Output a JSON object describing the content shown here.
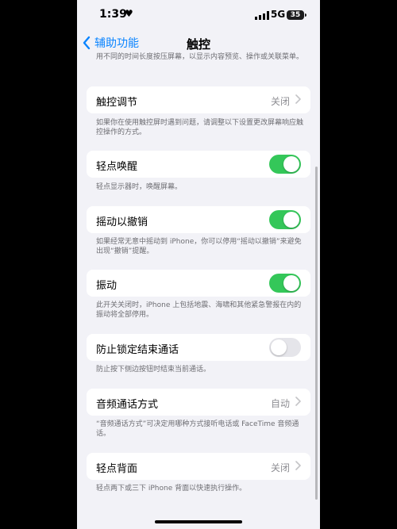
{
  "status": {
    "time": "1:39",
    "heart": "♥",
    "network": "5G",
    "battery": "35"
  },
  "nav": {
    "back_label": "辅助功能",
    "title": "触控"
  },
  "intro_note": "用不同的时间长度按压屏幕，以显示内容预览、操作或关联菜单。",
  "items": [
    {
      "label": "触控调节",
      "type": "link",
      "value": "关闭",
      "note": "如果你在使用触控屏时遇到问题，请调整以下设置更改屏幕响应触控操作的方式。"
    },
    {
      "label": "轻点唤醒",
      "type": "toggle",
      "state": true,
      "note": "轻点显示器时，唤醒屏幕。"
    },
    {
      "label": "摇动以撤销",
      "type": "toggle",
      "state": true,
      "note": "如果经常无意中摇动到 iPhone，你可以停用“摇动以撤销”来避免出现“撤销”提醒。"
    },
    {
      "label": "振动",
      "type": "toggle",
      "state": true,
      "note": "此开关关闭时，iPhone 上包括地震、海啸和其他紧急警报在内的振动将全部停用。"
    },
    {
      "label": "防止锁定结束通话",
      "type": "toggle",
      "state": false,
      "note": "防止按下侧边按钮时结束当前通话。"
    },
    {
      "label": "音频通话方式",
      "type": "link",
      "value": "自动",
      "note": "“音频通话方式”可决定用哪种方式接听电话或 FaceTime 音频通话。"
    },
    {
      "label": "轻点背面",
      "type": "link",
      "value": "关闭",
      "note": "轻点两下或三下 iPhone 背面以快速执行操作。"
    }
  ],
  "colors": {
    "accent": "#0a84ff",
    "toggle_on": "#34c759",
    "toggle_off": "#e5e5ea",
    "background": "#f2f2f7"
  }
}
